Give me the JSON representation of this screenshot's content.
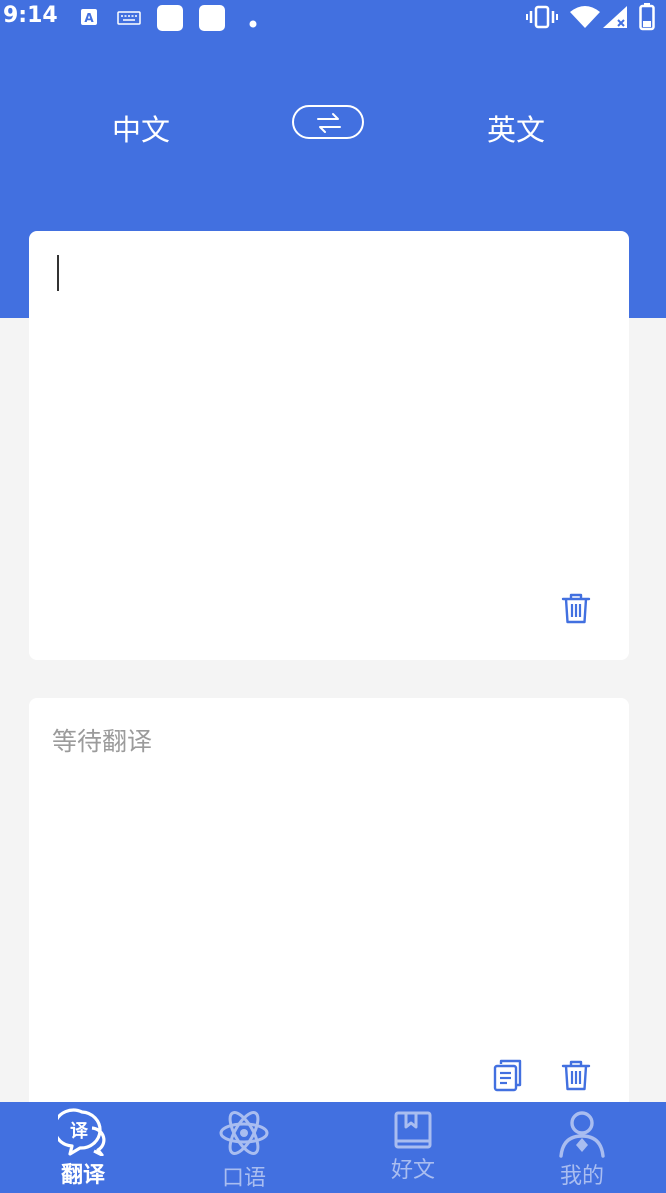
{
  "status_bar": {
    "time": "9:14",
    "icons": [
      "a-notification-icon",
      "keyboard-icon",
      "app-square-icon",
      "app-square-icon",
      "dot-icon",
      "vibrate-icon",
      "wifi-icon",
      "signal-icon",
      "battery-icon"
    ]
  },
  "languages": {
    "source": "中文",
    "target": "英文",
    "swap_icon": "swap-arrows-icon"
  },
  "input": {
    "value": "",
    "delete_icon": "trash-icon"
  },
  "output": {
    "placeholder": "等待翻译",
    "copy_icon": "copy-icon",
    "delete_icon": "trash-icon"
  },
  "tabs": [
    {
      "label": "翻译",
      "icon": "translate-icon",
      "active": true
    },
    {
      "label": "口语",
      "icon": "atom-icon",
      "active": false
    },
    {
      "label": "好文",
      "icon": "book-icon",
      "active": false
    },
    {
      "label": "我的",
      "icon": "user-icon",
      "active": false
    }
  ],
  "colors": {
    "primary": "#4270e0",
    "background": "#f4f4f4",
    "tab_active": "#ffffff",
    "tab_inactive": "#a9bdf0",
    "placeholder": "#9b9b9b"
  }
}
